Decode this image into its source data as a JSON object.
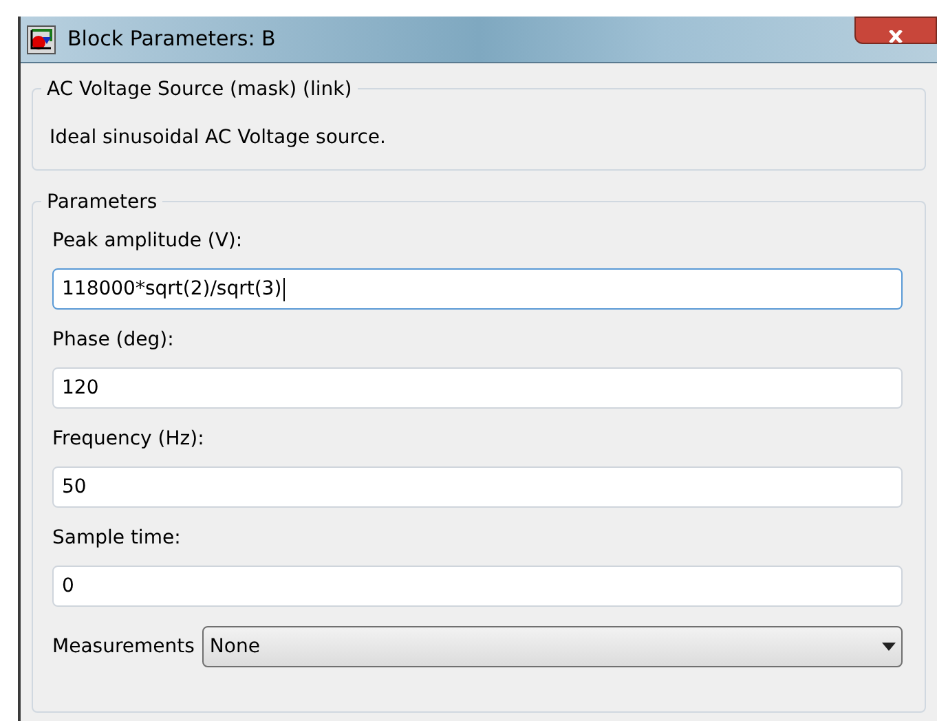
{
  "window": {
    "title": "Block Parameters: B"
  },
  "description_group": {
    "title": "AC Voltage Source (mask) (link)",
    "text": "Ideal sinusoidal AC Voltage source."
  },
  "parameters_group": {
    "title": "Parameters",
    "fields": [
      {
        "label": "Peak amplitude (V):",
        "value": "118000*sqrt(2)/sqrt(3)",
        "focused": true
      },
      {
        "label": "Phase (deg):",
        "value": "120",
        "focused": false
      },
      {
        "label": "Frequency (Hz):",
        "value": "50",
        "focused": false
      },
      {
        "label": "Sample time:",
        "value": "0",
        "focused": false
      }
    ],
    "dropdown": {
      "label": "Measurements",
      "value": "None"
    }
  }
}
